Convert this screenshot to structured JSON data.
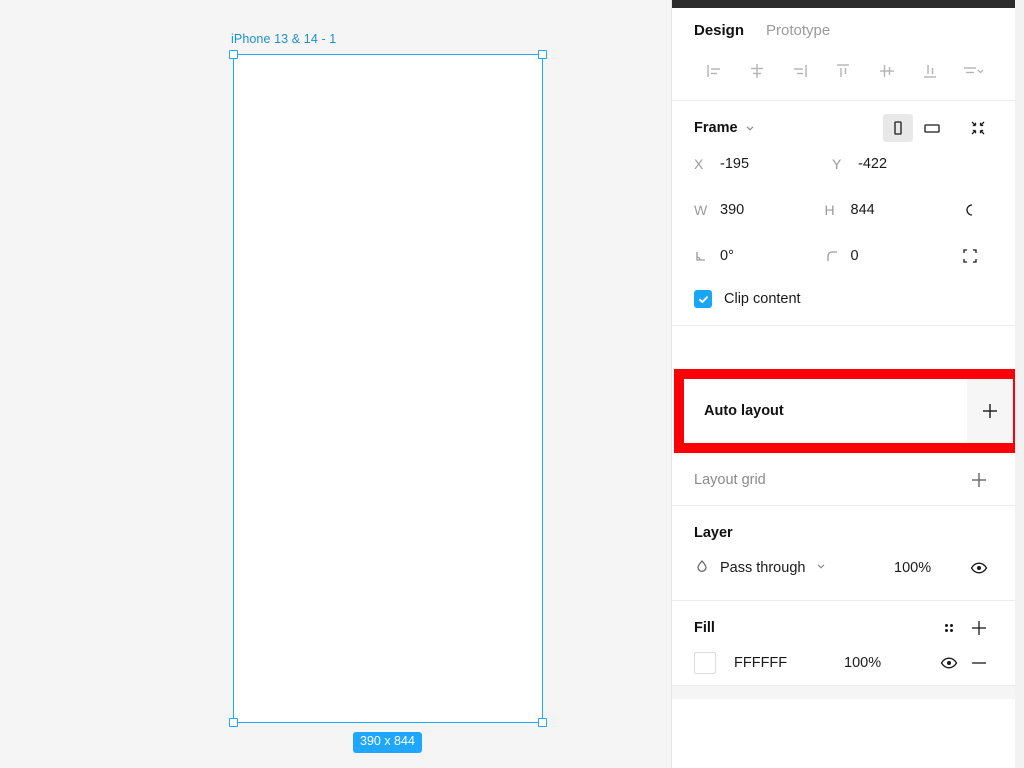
{
  "canvas": {
    "frame_label": "iPhone 13 & 14 - 1",
    "dimension_badge": "390 x 844",
    "frame_fill": "#FFFFFF",
    "selection_color": "#1EA7FD",
    "background": "#F5F5F5"
  },
  "panel": {
    "tabs": [
      {
        "label": "Design",
        "active": true
      },
      {
        "label": "Prototype",
        "active": false
      }
    ],
    "align_tools": [
      {
        "name": "align-left-icon",
        "label": "Align left"
      },
      {
        "name": "align-horizontal-centers-icon",
        "label": "Align horizontal centers"
      },
      {
        "name": "align-right-icon",
        "label": "Align right"
      },
      {
        "name": "align-top-icon",
        "label": "Align top"
      },
      {
        "name": "align-vertical-centers-icon",
        "label": "Align vertical centers"
      },
      {
        "name": "align-bottom-icon",
        "label": "Align bottom"
      },
      {
        "name": "distribute-menu-icon",
        "label": "Distribute"
      }
    ],
    "frame": {
      "title": "Frame",
      "orientation_portrait": "portrait",
      "orientation_landscape": "landscape",
      "resize_to_fit": "Resize to fit",
      "x_label": "X",
      "x_value": "-195",
      "y_label": "Y",
      "y_value": "-422",
      "w_label": "W",
      "w_value": "390",
      "h_label": "H",
      "h_value": "844",
      "rotation_label": "rotation",
      "rotation_value": "0°",
      "corner_label": "corner-radius",
      "corner_value": "0",
      "constrain_proportions": "Constrain proportions",
      "independent_corners": "Independent corners",
      "clip_content_label": "Clip content",
      "clip_content_checked": true
    },
    "auto_layout": {
      "title": "Auto layout",
      "add_label": "+",
      "highlight_color": "#FB0007"
    },
    "layout_grid": {
      "title": "Layout grid",
      "add_label": "+"
    },
    "layer": {
      "title": "Layer",
      "blend_mode": "Pass through",
      "opacity": "100%",
      "visible": true
    },
    "fill": {
      "title": "Fill",
      "styles_label": "styles",
      "add_label": "+",
      "items": [
        {
          "color_hex": "FFFFFF",
          "opacity": "100%",
          "visible": true,
          "remove_label": "—"
        }
      ]
    }
  }
}
